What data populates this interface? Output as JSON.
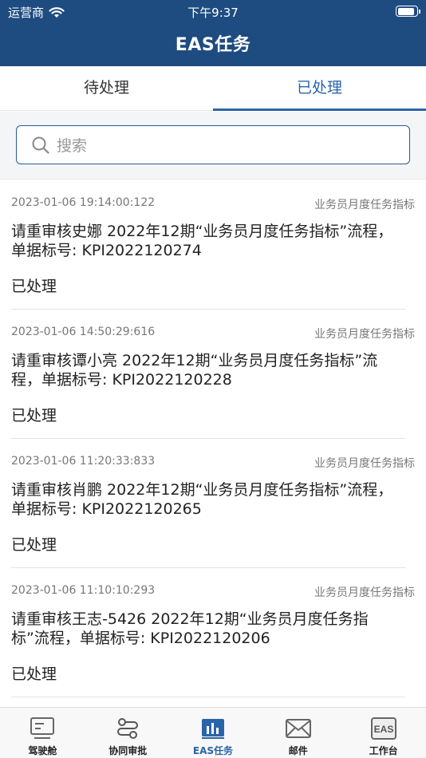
{
  "status_bar": {
    "carrier": "运营商",
    "time": "下午9:37",
    "battery_level": 0.9
  },
  "header": {
    "title": "EAS任务"
  },
  "tabs": [
    {
      "label": "待处理",
      "active": false
    },
    {
      "label": "已处理",
      "active": true
    }
  ],
  "search": {
    "placeholder": "搜索"
  },
  "items": [
    {
      "date": "2023-01-06 19:14:00:122",
      "category": "业务员月度任务指标",
      "title": "请重审核史娜 2022年12期“业务员月度任务指标”流程，单据标号: KPI2022120274",
      "status": "已处理"
    },
    {
      "date": "2023-01-06 14:50:29:616",
      "category": "业务员月度任务指标",
      "title": "请重审核谭小亮 2022年12期“业务员月度任务指标”流程，单据标号: KPI2022120228",
      "status": "已处理"
    },
    {
      "date": "2023-01-06 11:20:33:833",
      "category": "业务员月度任务指标",
      "title": "请重审核肖鹏 2022年12期“业务员月度任务指标”流程，单据标号: KPI2022120265",
      "status": "已处理"
    },
    {
      "date": "2023-01-06 11:10:10:293",
      "category": "业务员月度任务指标",
      "title": "请重审核王志-5426 2022年12期“业务员月度任务指标”流程，单据标号: KPI2022120206",
      "status": "已处理"
    }
  ],
  "bottom_nav": [
    {
      "label": "驾驶舱",
      "icon": "dashboard-icon",
      "active": false
    },
    {
      "label": "协同审批",
      "icon": "workflow-icon",
      "active": false
    },
    {
      "label": "EAS任务",
      "icon": "bar-chart-icon",
      "active": true
    },
    {
      "label": "邮件",
      "icon": "mail-icon",
      "active": false
    },
    {
      "label": "工作台",
      "icon": "eas-workbench-icon",
      "active": false
    }
  ],
  "colors": {
    "header_bg": "#1e4c80",
    "accent": "#2a64a8"
  }
}
